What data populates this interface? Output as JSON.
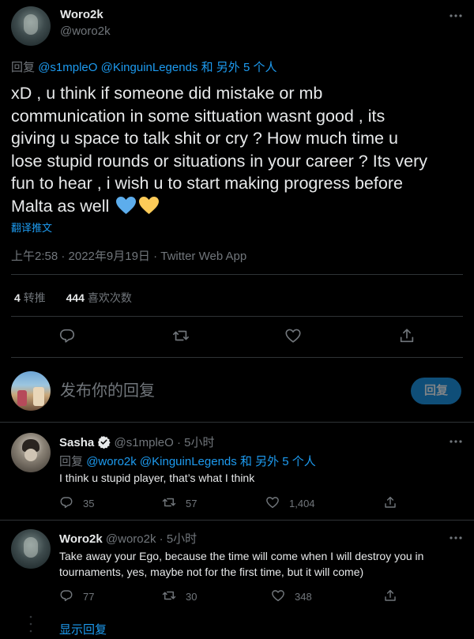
{
  "main_tweet": {
    "author_name": "Woro2k",
    "author_handle": "@woro2k",
    "reply_prefix": "回复",
    "reply_mentions": "@s1mpleO @KinguinLegends",
    "reply_others": "和 另外 5 个人",
    "text_lines": [
      "xD , u think if someone did mistake or mb",
      "communication in some sittuation wasnt good , its",
      "giving u space to talk shit or cry ?  How much time u",
      "lose stupid rounds or situations in your career ? Its very",
      "fun to hear ,  i wish u to start making progress before",
      "Malta as well"
    ],
    "translate": "翻译推文",
    "timestamp": "上午2:58 · 2022年9月19日 · Twitter Web App",
    "retweets_count": "4",
    "retweets_label": "转推",
    "likes_count": "444",
    "likes_label": "喜欢次数"
  },
  "composer": {
    "placeholder": "发布你的回复",
    "button": "回复"
  },
  "replies": [
    {
      "author_name": "Sasha",
      "verified": true,
      "author_handle": "@s1mpleO",
      "time": "· 5小时",
      "reply_prefix": "回复",
      "reply_mentions": "@woro2k @KinguinLegends",
      "reply_others": "和 另外 5 个人",
      "text": "I think u stupid player, that’s what I think",
      "replies_count": "35",
      "retweets_count": "57",
      "likes_count": "1,404"
    },
    {
      "author_name": "Woro2k",
      "author_handle": "@woro2k",
      "time": "· 5小时",
      "text_lines": [
        "Take away your Ego, because the time will come when I will destroy you in",
        "tournaments, yes, maybe not for the first time, but it will come)"
      ],
      "replies_count": "77",
      "retweets_count": "30",
      "likes_count": "348",
      "show_replies": "显示回复"
    }
  ],
  "colors": {
    "accent": "#1d9bf0",
    "background": "#000000",
    "muted": "#71767b",
    "divider": "#2f3336"
  }
}
